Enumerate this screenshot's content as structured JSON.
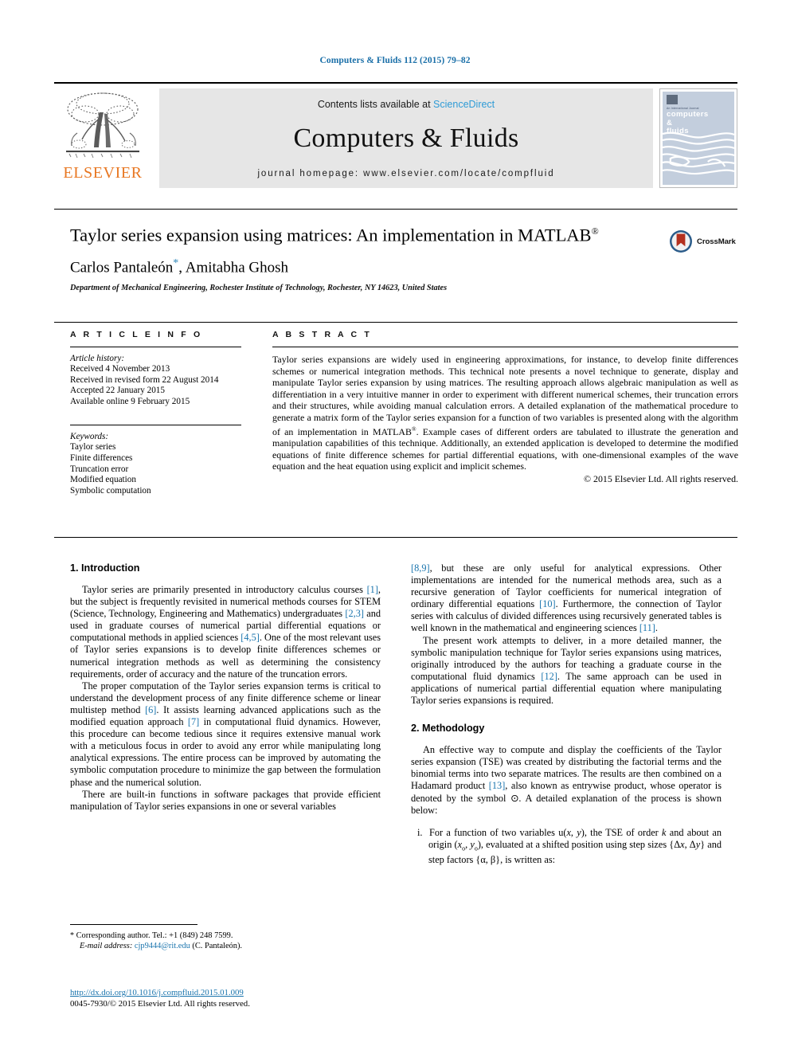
{
  "running_head": "Computers & Fluids 112 (2015) 79–82",
  "masthead": {
    "publisher_name": "ELSEVIER",
    "contents_prefix": "Contents lists available at ",
    "contents_link": "ScienceDirect",
    "journal_title": "Computers & Fluids",
    "homepage": "journal homepage: www.elsevier.com/locate/compfluid",
    "cover": {
      "sub": "An International Journal",
      "line1": "computers",
      "line2": "&",
      "line3": "fluids"
    }
  },
  "article": {
    "title": "Taylor series expansion using matrices: An implementation in MATLAB",
    "title_superscript": "®",
    "authors": "Carlos Pantaleón",
    "authors_tail": ", Amitabha Ghosh",
    "corresponding_marker": "*",
    "affiliation": "Department of Mechanical Engineering, Rochester Institute of Technology, Rochester, NY 14623, United States",
    "crossmark_label": "CrossMark"
  },
  "info": {
    "heading": "A R T I C L E   I N F O",
    "history_label": "Article history:",
    "history": [
      "Received 4 November 2013",
      "Received in revised form 22 August 2014",
      "Accepted 22 January 2015",
      "Available online 9 February 2015"
    ],
    "keywords_label": "Keywords:",
    "keywords": [
      "Taylor series",
      "Finite differences",
      "Truncation error",
      "Modified equation",
      "Symbolic computation"
    ]
  },
  "abstract": {
    "heading": "A B S T R A C T",
    "body_part1": "Taylor series expansions are widely used in engineering approximations, for instance, to develop finite differences schemes or numerical integration methods. This technical note presents a novel technique to generate, display and manipulate Taylor series expansion by using matrices. The resulting approach allows algebraic manipulation as well as differentiation in a very intuitive manner in order to experiment with different numerical schemes, their truncation errors and their structures, while avoiding manual calculation errors. A detailed explanation of the mathematical procedure to generate a matrix form of the Taylor series expansion for a function of two variables is presented along with the algorithm of an implementation in MATLAB",
    "body_sup": "®",
    "body_part2": ". Example cases of different orders are tabulated to illustrate the generation and manipulation capabilities of this technique. Additionally, an extended application is developed to determine the modified equations of finite difference schemes for partial differential equations, with one-dimensional examples of the wave equation and the heat equation using explicit and implicit schemes.",
    "copyright": "© 2015 Elsevier Ltd. All rights reserved."
  },
  "sections": {
    "intro_heading": "1. Introduction",
    "methodology_heading": "2. Methodology",
    "intro_p1_a": "Taylor series are primarily presented in introductory calculus courses ",
    "intro_p1_r1": "[1]",
    "intro_p1_b": ", but the subject is frequently revisited in numerical methods courses for STEM (Science, Technology, Engineering and Mathematics) undergraduates ",
    "intro_p1_r2": "[2,3]",
    "intro_p1_c": " and used in graduate courses of numerical partial differential equations or computational methods in applied sciences ",
    "intro_p1_r3": "[4,5]",
    "intro_p1_d": ". One of the most relevant uses of Taylor series expansions is to develop finite differences schemes or numerical integration methods as well as determining the consistency requirements, order of accuracy and the nature of the truncation errors.",
    "intro_p2_a": "The proper computation of the Taylor series expansion terms is critical to understand the development process of any finite difference scheme or linear multistep method ",
    "intro_p2_r1": "[6]",
    "intro_p2_b": ". It assists learning advanced applications such as the modified equation approach ",
    "intro_p2_r2": "[7]",
    "intro_p2_c": " in computational fluid dynamics. However, this procedure can become tedious since it requires extensive manual work with a meticulous focus in order to avoid any error while manipulating long analytical expressions. The entire process can be improved by automating the symbolic computation procedure to minimize the gap between the formulation phase and the numerical solution.",
    "intro_p3_a": "There are built-in functions in software packages that provide efficient manipulation of Taylor series expansions in one or several variables ",
    "intro_p3_r1": "[8,9]",
    "intro_p3_b": ", but these are only useful for analytical expressions. Other implementations are intended for the numerical methods area, such as a recursive generation of Taylor coefficients for numerical integration of ordinary differential equations ",
    "intro_p3_r2": "[10]",
    "intro_p3_c": ". Furthermore, the connection of Taylor series with calculus of divided differences using recursively generated tables is well known in the mathematical and engineering sciences ",
    "intro_p3_r3": "[11]",
    "intro_p3_d": ".",
    "intro_p4_a": "The present work attempts to deliver, in a more detailed manner, the symbolic manipulation technique for Taylor series expansions using matrices, originally introduced by the authors for teaching a graduate course in the computational fluid dynamics ",
    "intro_p4_r1": "[12]",
    "intro_p4_b": ". The same approach can be used in applications of numerical partial differential equation where manipulating Taylor series expansions is required.",
    "method_p1_a": "An effective way to compute and display the coefficients of the Taylor series expansion (TSE) was created by distributing the factorial terms and the binomial terms into two separate matrices. The results are then combined on a Hadamard product ",
    "method_p1_r1": "[13]",
    "method_p1_b": ", also known as entrywise product, whose operator is denoted by the symbol ⊙. A detailed explanation of the process is shown below:",
    "method_item_marker": "i.",
    "method_item_a": "For a function of two variables u(",
    "method_item_x": "x",
    "method_item_comma": ", ",
    "method_item_y": "y",
    "method_item_b": "), the TSE of order ",
    "method_item_k": "k",
    "method_item_c": " and about an origin (",
    "method_item_xo": "x",
    "method_item_osub": "o",
    "method_item_d": ", ",
    "method_item_yo": "y",
    "method_item_e": "), evaluated at a shifted position using step sizes {Δ",
    "method_item_dx": "x",
    "method_item_f": ", Δ",
    "method_item_dy": "y",
    "method_item_g": "} and step factors {α, β}, is written as:"
  },
  "footer": {
    "corr_marker": "*",
    "corr_text": "Corresponding author. Tel.: +1 (849) 248 7599.",
    "email_label": "E-mail address:",
    "email": "cjp9444@rit.edu",
    "email_suffix": "(C. Pantaleón).",
    "doi": "http://dx.doi.org/10.1016/j.compfluid.2015.01.009",
    "issn": "0045-7930/© 2015 Elsevier Ltd. All rights reserved."
  },
  "colors": {
    "link": "#1a74ad",
    "sciencedirect": "#2e9bd6",
    "elsevier_orange": "#E87722",
    "banner_gray": "#e6e6e6"
  }
}
